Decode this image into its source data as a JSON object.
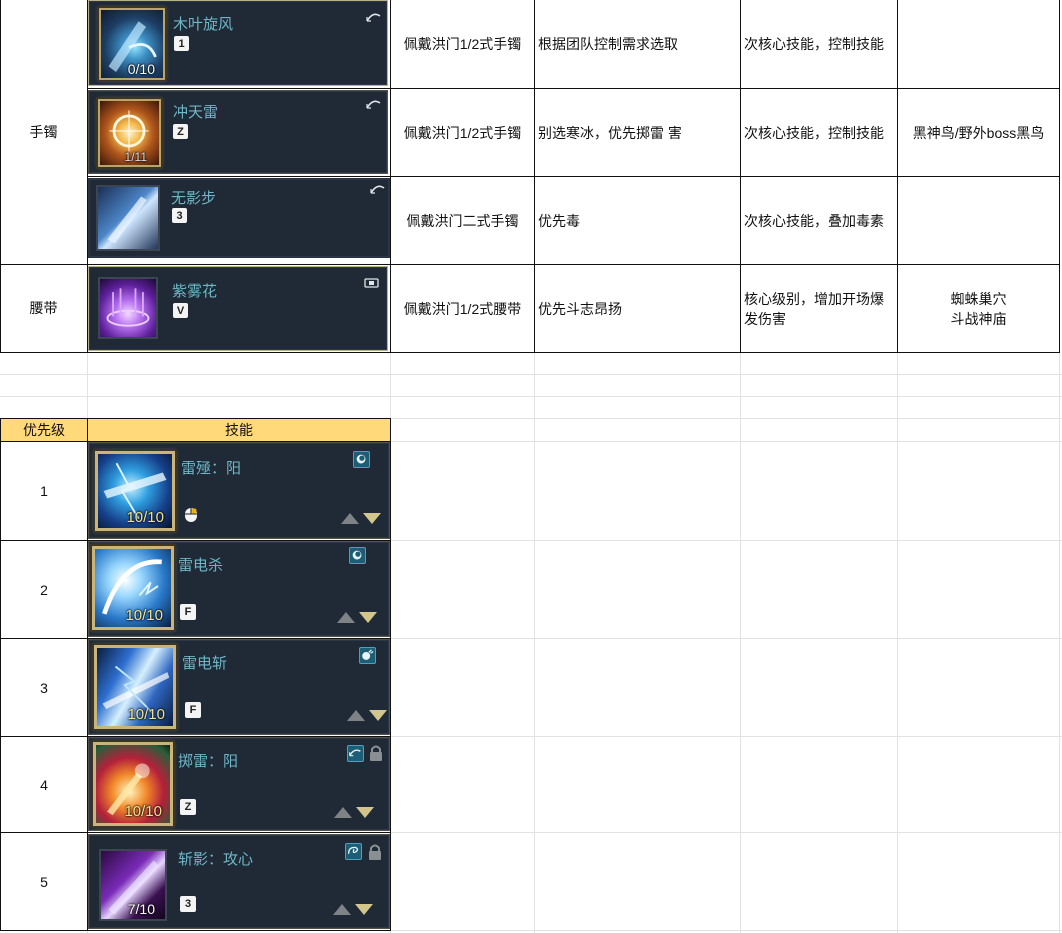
{
  "top_table": {
    "rows": [
      {
        "category": "手镯",
        "skill": {
          "name": "木叶旋风",
          "key": "1",
          "level": "0/10"
        },
        "set": "佩戴洪门1/2式手镯",
        "note": "根据团队控制需求选取",
        "role": "次核心技能，控制技能",
        "source": ""
      },
      {
        "category": "",
        "skill": {
          "name": "冲天雷",
          "key": "Z",
          "level": "1/11"
        },
        "set": "佩戴洪门1/2式手镯",
        "note": "别选寒冰，优先掷雷 害",
        "role": "次核心技能，控制技能",
        "source": "黑神鸟/野外boss黑鸟"
      },
      {
        "category": "",
        "skill": {
          "name": "无影步",
          "key": "3",
          "level": ""
        },
        "set": "佩戴洪门二式手镯",
        "note": "优先毒",
        "role": "次核心技能，叠加毒素",
        "source": ""
      },
      {
        "category": "腰带",
        "skill": {
          "name": "紫雾花",
          "key": "V",
          "level": ""
        },
        "set": "佩戴洪门1/2式腰带",
        "note": "优先斗志昂扬",
        "role": "核心级别，增加开场爆\n发伤害",
        "source": "蜘蛛巢穴\n斗战神庙"
      }
    ]
  },
  "priority_table": {
    "headers": {
      "priority": "优先级",
      "skill": "技能"
    },
    "rows": [
      {
        "priority": "1",
        "name": "雷殛：阳",
        "key": "",
        "level": "10/10",
        "input": "mouse-icon"
      },
      {
        "priority": "2",
        "name": "雷电杀",
        "key": "F",
        "level": "10/10",
        "input": "key"
      },
      {
        "priority": "3",
        "name": "雷电斩",
        "key": "F",
        "level": "10/10",
        "input": "key"
      },
      {
        "priority": "4",
        "name": "掷雷：阳",
        "key": "Z",
        "level": "10/10",
        "input": "key"
      },
      {
        "priority": "5",
        "name": "斩影：攻心",
        "key": "3",
        "level": "7/10",
        "input": "key"
      }
    ]
  },
  "colors": {
    "header_fill": "#ffd97a",
    "card_bg": "#1f2a36",
    "skill_name": "#6fb6c7",
    "level_gold": "#f2e391"
  }
}
